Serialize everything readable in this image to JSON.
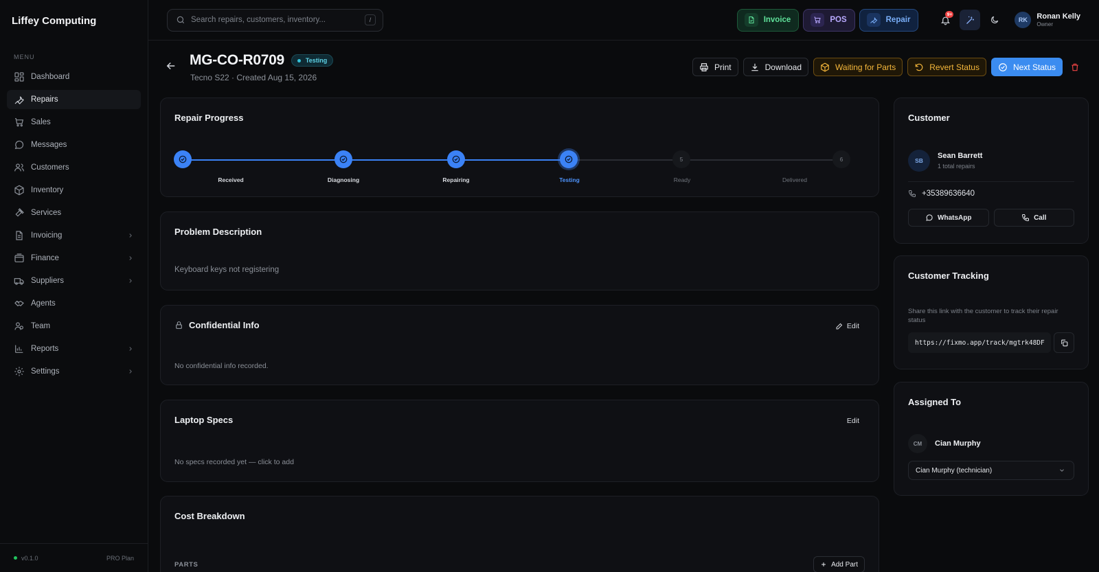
{
  "app": {
    "brand": "Liffey Computing",
    "version": "v0.1.0",
    "plan": "PRO Plan"
  },
  "sidebar": {
    "menu_label": "MENU",
    "items": [
      {
        "label": "Dashboard",
        "icon": "dashboard-icon",
        "chevron": false,
        "active": false
      },
      {
        "label": "Repairs",
        "icon": "wrench-icon",
        "chevron": false,
        "active": true
      },
      {
        "label": "Sales",
        "icon": "cart-icon",
        "chevron": false,
        "active": false
      },
      {
        "label": "Messages",
        "icon": "message-icon",
        "chevron": false,
        "active": false
      },
      {
        "label": "Customers",
        "icon": "users-icon",
        "chevron": false,
        "active": false
      },
      {
        "label": "Inventory",
        "icon": "box-icon",
        "chevron": false,
        "active": false
      },
      {
        "label": "Services",
        "icon": "hammer-icon",
        "chevron": false,
        "active": false
      },
      {
        "label": "Invoicing",
        "icon": "file-icon",
        "chevron": true,
        "active": false
      },
      {
        "label": "Finance",
        "icon": "wallet-icon",
        "chevron": true,
        "active": false
      },
      {
        "label": "Suppliers",
        "icon": "truck-icon",
        "chevron": true,
        "active": false
      },
      {
        "label": "Agents",
        "icon": "handshake-icon",
        "chevron": false,
        "active": false
      },
      {
        "label": "Team",
        "icon": "team-icon",
        "chevron": false,
        "active": false
      },
      {
        "label": "Reports",
        "icon": "bar-chart-icon",
        "chevron": true,
        "active": false
      },
      {
        "label": "Settings",
        "icon": "gear-icon",
        "chevron": true,
        "active": false
      }
    ]
  },
  "topbar": {
    "search_placeholder": "Search repairs, customers, inventory...",
    "search_shortcut": "/",
    "quick_actions": [
      {
        "label": "Invoice",
        "icon": "invoice-icon",
        "color": "#5fe19a"
      },
      {
        "label": "POS",
        "icon": "cart-icon",
        "color": "#b9a9ff"
      },
      {
        "label": "Repair",
        "icon": "wrench-icon",
        "color": "#79aef8"
      }
    ],
    "notification_badge": "9+",
    "user": {
      "initials": "RK",
      "name": "Ronan Kelly",
      "role": "Owner"
    }
  },
  "repair": {
    "id": "MG-CO-R0709",
    "status": "Testing",
    "subtitle": "Tecno S22 · Created Aug 15, 2026",
    "actions": {
      "print": "Print",
      "download": "Download",
      "waiting": "Waiting for Parts",
      "revert": "Revert Status",
      "next": "Next Status"
    }
  },
  "progress": {
    "title": "Repair Progress",
    "current_index": 3,
    "steps": [
      {
        "number": "1",
        "label": "Received"
      },
      {
        "number": "2",
        "label": "Diagnosing"
      },
      {
        "number": "3",
        "label": "Repairing"
      },
      {
        "number": "4",
        "label": "Testing"
      },
      {
        "number": "5",
        "label": "Ready"
      },
      {
        "number": "6",
        "label": "Delivered"
      }
    ]
  },
  "problem": {
    "title": "Problem Description",
    "text": "Keyboard keys not registering"
  },
  "confidential": {
    "title": "Confidential Info",
    "edit": "Edit",
    "text": "No confidential info recorded."
  },
  "specs": {
    "title": "Laptop Specs",
    "edit": "Edit",
    "text": "No specs recorded yet — click to add"
  },
  "cost": {
    "title": "Cost Breakdown",
    "parts_label": "PARTS",
    "add_part": "Add Part"
  },
  "customer": {
    "title": "Customer",
    "initials": "SB",
    "name": "Sean Barrett",
    "repairs": "1 total repairs",
    "phone": "+35389636640",
    "whatsapp": "WhatsApp",
    "call": "Call"
  },
  "tracking": {
    "title": "Customer Tracking",
    "description": "Share this link with the customer to track their repair status",
    "link": "https://fixmo.app/track/mgtrk48DF"
  },
  "assigned": {
    "title": "Assigned To",
    "initials": "CM",
    "name": "Cian Murphy",
    "select_value": "Cian Murphy (technician)"
  }
}
